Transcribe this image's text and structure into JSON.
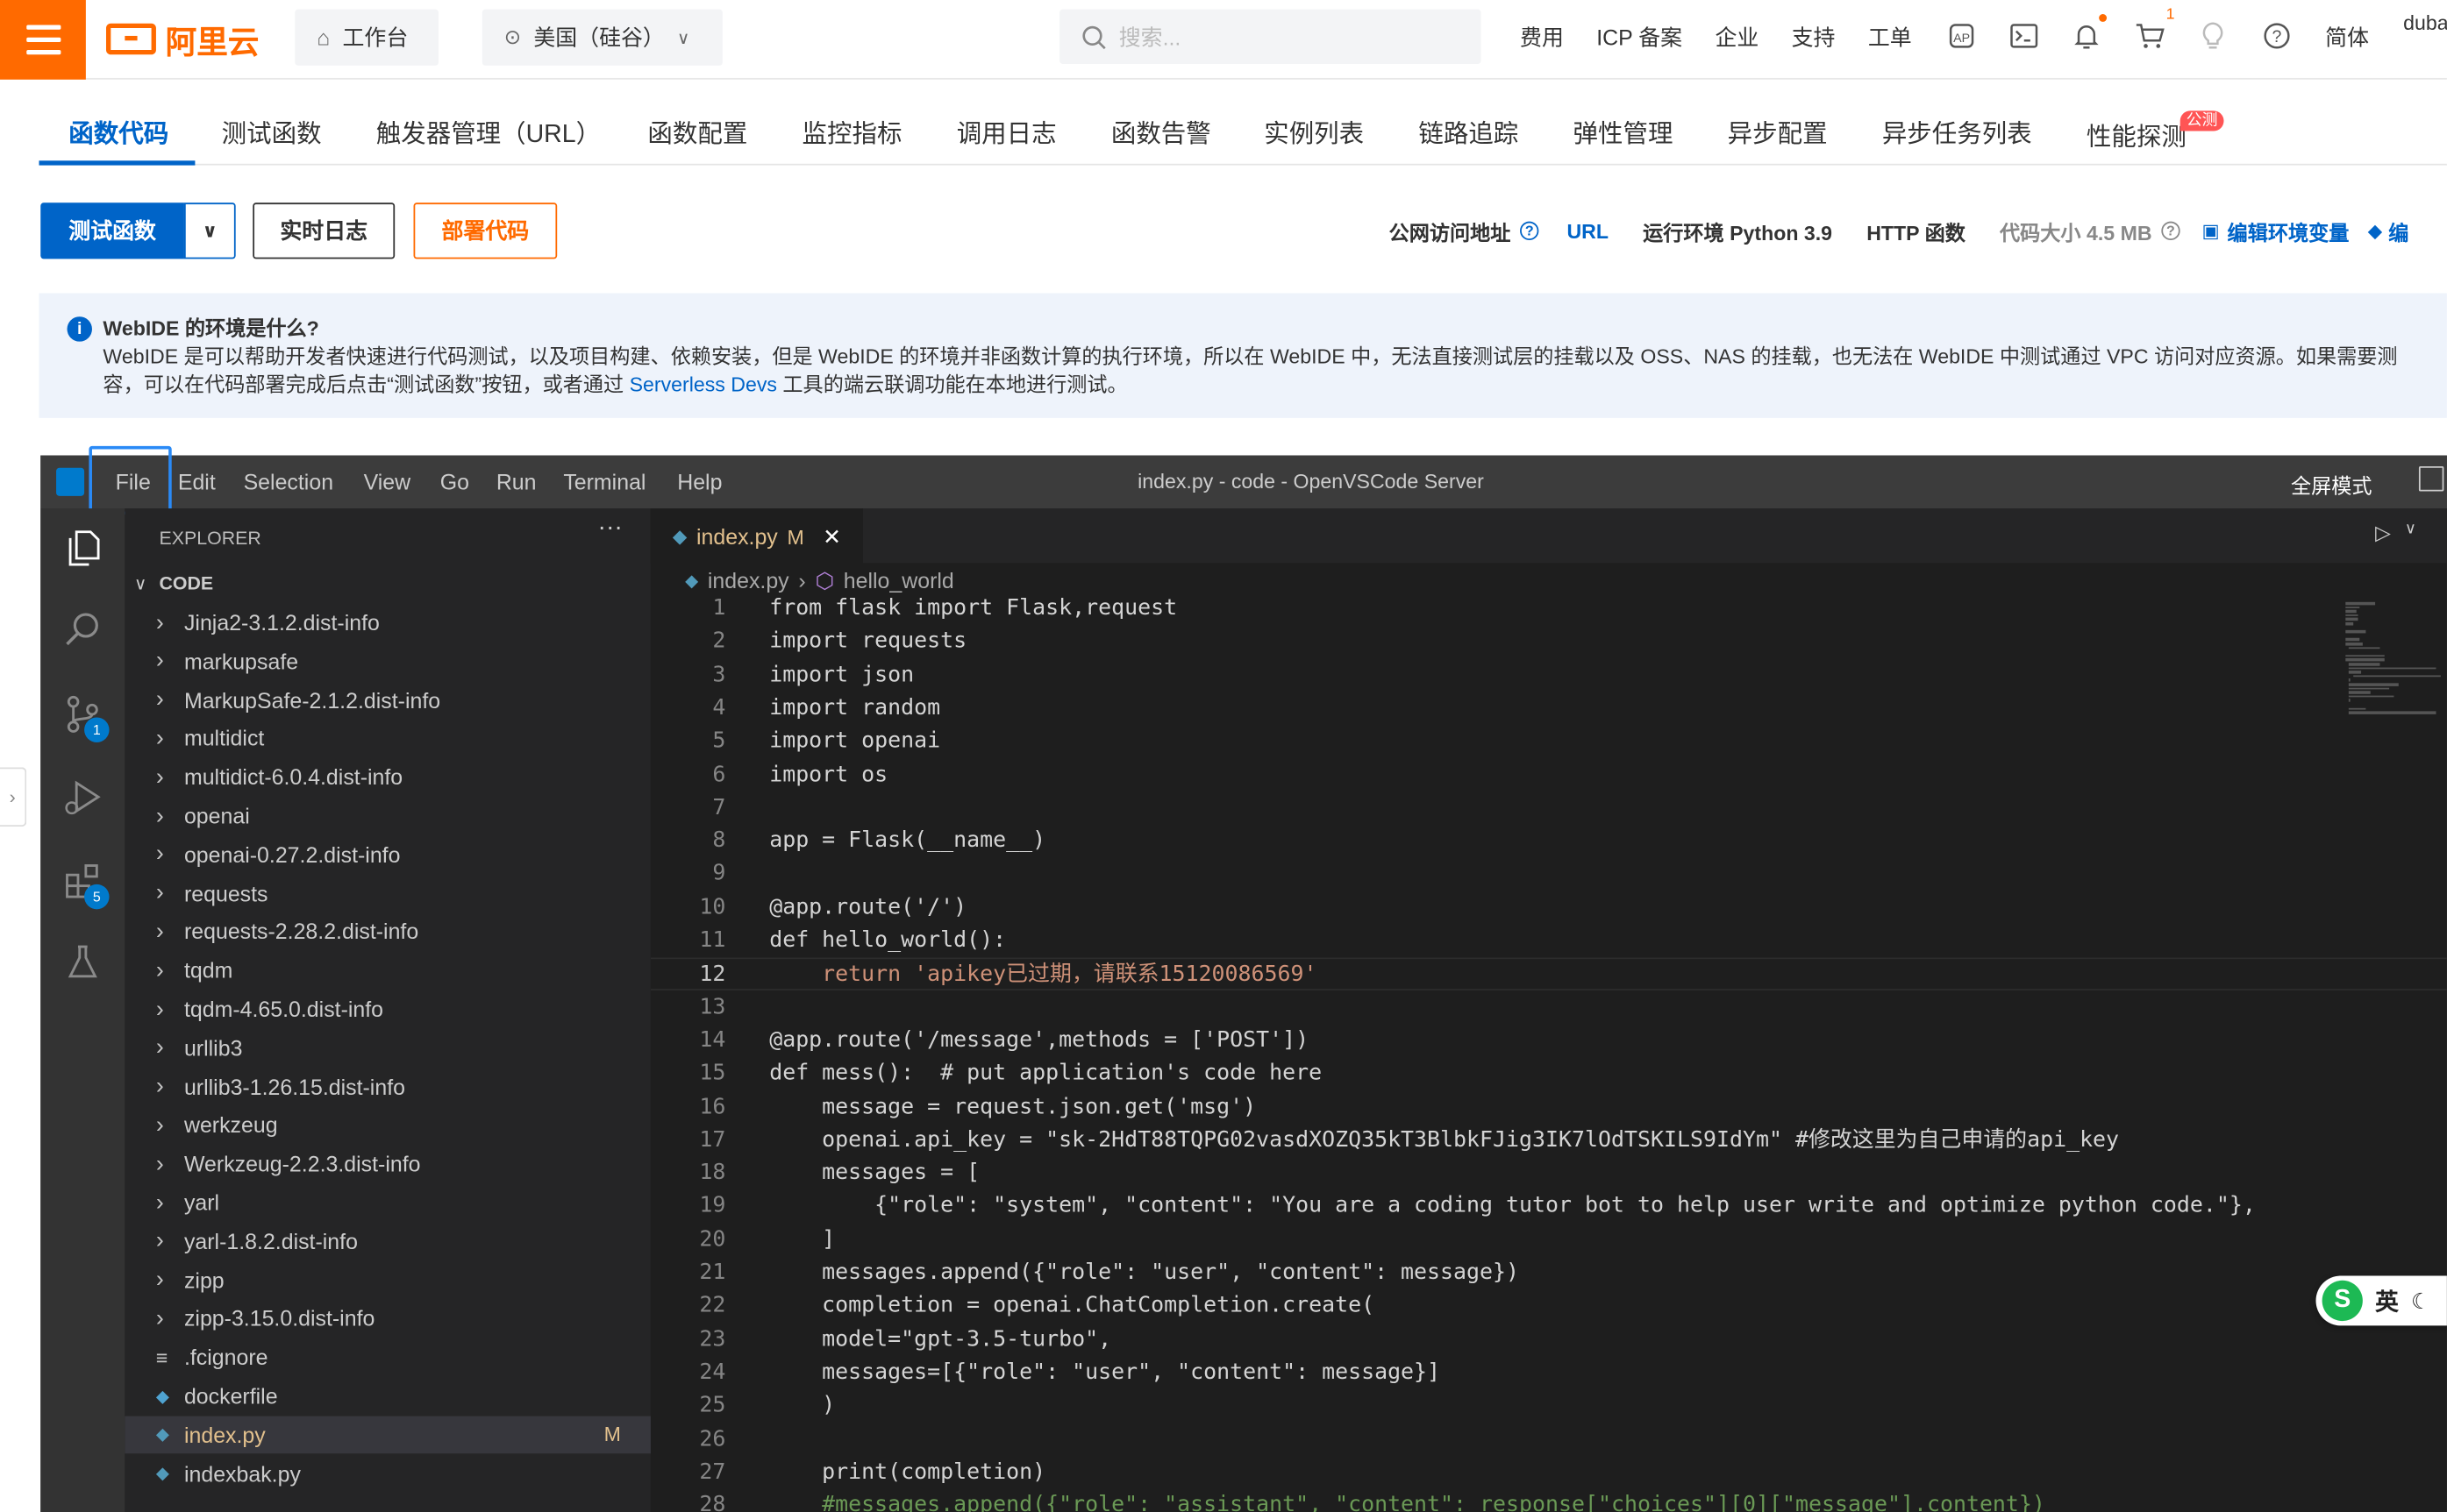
{
  "topbar": {
    "logo_text": "阿里云",
    "workbench": "工作台",
    "region": "美国（硅谷）",
    "search_placeholder": "搜索...",
    "nav": [
      "费用",
      "ICP 备案",
      "企业",
      "支持",
      "工单"
    ],
    "lang": "简体",
    "user": "duba",
    "cart_count": "1",
    "icons": [
      "ap-icon",
      "terminal-icon",
      "bell-icon",
      "cart-icon",
      "bulb-icon",
      "help-icon"
    ]
  },
  "tabs": [
    "函数代码",
    "测试函数",
    "触发器管理（URL）",
    "函数配置",
    "监控指标",
    "调用日志",
    "函数告警",
    "实例列表",
    "链路追踪",
    "弹性管理",
    "异步配置",
    "异步任务列表",
    "性能探测"
  ],
  "tab_badge": "公测",
  "actions": {
    "test": "测试函数",
    "logs": "实时日志",
    "deploy": "部署代码"
  },
  "info": {
    "public_url_label": "公网访问地址",
    "url": "URL",
    "runtime": "运行环境 Python 3.9",
    "http": "HTTP 函数",
    "code_size": "代码大小 4.5 MB",
    "edit_env": "编辑环境变量",
    "more": "编"
  },
  "notice": {
    "title": "WebIDE 的环境是什么?",
    "line1": "WebIDE 是可以帮助开发者快速进行代码测试，以及项目构建、依赖安装，但是 WebIDE 的环境并非函数计算的执行环境，所以在 WebIDE 中，无法直接测试层的挂载以及 OSS、NAS 的挂载，也无法在 WebIDE 中测试通过 VPC 访问对应资源。如果需要测",
    "line2_a": "容，可以在代码部署完成后点击“测试函数”按钮，或者通过",
    "line2_link": "Serverless Devs",
    "line2_b": "工具的端云联调功能在本地进行测试。"
  },
  "ide": {
    "menu": [
      "File",
      "Edit",
      "Selection",
      "View",
      "Go",
      "Run",
      "Terminal",
      "Help"
    ],
    "title": "index.py - code - OpenVSCode Server",
    "fullscreen": "全屏模式",
    "explorer_title": "EXPLORER",
    "folder": "CODE",
    "badges": {
      "scm": "1",
      "extensions": "5"
    },
    "tree": [
      {
        "name": "Jinja2-3.1.2.dist-info",
        "type": "folder"
      },
      {
        "name": "markupsafe",
        "type": "folder"
      },
      {
        "name": "MarkupSafe-2.1.2.dist-info",
        "type": "folder"
      },
      {
        "name": "multidict",
        "type": "folder"
      },
      {
        "name": "multidict-6.0.4.dist-info",
        "type": "folder"
      },
      {
        "name": "openai",
        "type": "folder"
      },
      {
        "name": "openai-0.27.2.dist-info",
        "type": "folder"
      },
      {
        "name": "requests",
        "type": "folder"
      },
      {
        "name": "requests-2.28.2.dist-info",
        "type": "folder"
      },
      {
        "name": "tqdm",
        "type": "folder"
      },
      {
        "name": "tqdm-4.65.0.dist-info",
        "type": "folder"
      },
      {
        "name": "urllib3",
        "type": "folder"
      },
      {
        "name": "urllib3-1.26.15.dist-info",
        "type": "folder"
      },
      {
        "name": "werkzeug",
        "type": "folder"
      },
      {
        "name": "Werkzeug-2.2.3.dist-info",
        "type": "folder"
      },
      {
        "name": "yarl",
        "type": "folder"
      },
      {
        "name": "yarl-1.8.2.dist-info",
        "type": "folder"
      },
      {
        "name": "zipp",
        "type": "folder"
      },
      {
        "name": "zipp-3.15.0.dist-info",
        "type": "folder"
      },
      {
        "name": ".fcignore",
        "type": "file"
      },
      {
        "name": "dockerfile",
        "type": "docker"
      },
      {
        "name": "index.py",
        "type": "py",
        "status": "M",
        "selected": true
      },
      {
        "name": "indexbak.py",
        "type": "py"
      }
    ],
    "tab_name": "index.py",
    "tab_status": "M",
    "breadcrumb": [
      "index.py",
      "hello_world"
    ],
    "current_line": 12,
    "code": [
      "from flask import Flask,request",
      "import requests",
      "import json",
      "import random",
      "import openai",
      "import os",
      "",
      "app = Flask(__name__)",
      "",
      "@app.route('/')",
      "def hello_world():",
      "    return 'apikey已过期，请联系15120086569'",
      "",
      "@app.route('/message',methods = ['POST'])",
      "def mess():  # put application's code here",
      "    message = request.json.get('msg')",
      "    openai.api_key = \"sk-2HdT88TQPG02vasdXOZQ35kT3BlbkFJig3IK7lOdTSKILS9IdYm\" #修改这里为自己申请的api_key",
      "    messages = [",
      "        {\"role\": \"system\", \"content\": \"You are a coding tutor bot to help user write and optimize python code.\"},",
      "    ]",
      "    messages.append({\"role\": \"user\", \"content\": message})",
      "    completion = openai.ChatCompletion.create(",
      "    model=\"gpt-3.5-turbo\",",
      "    messages=[{\"role\": \"user\", \"content\": message}]",
      "    )",
      "",
      "    print(completion)",
      "    #messages.append({\"role\": \"assistant\", \"content\": response[\"choices\"][0][\"message\"].content})"
    ]
  },
  "ime": {
    "label": "英"
  }
}
